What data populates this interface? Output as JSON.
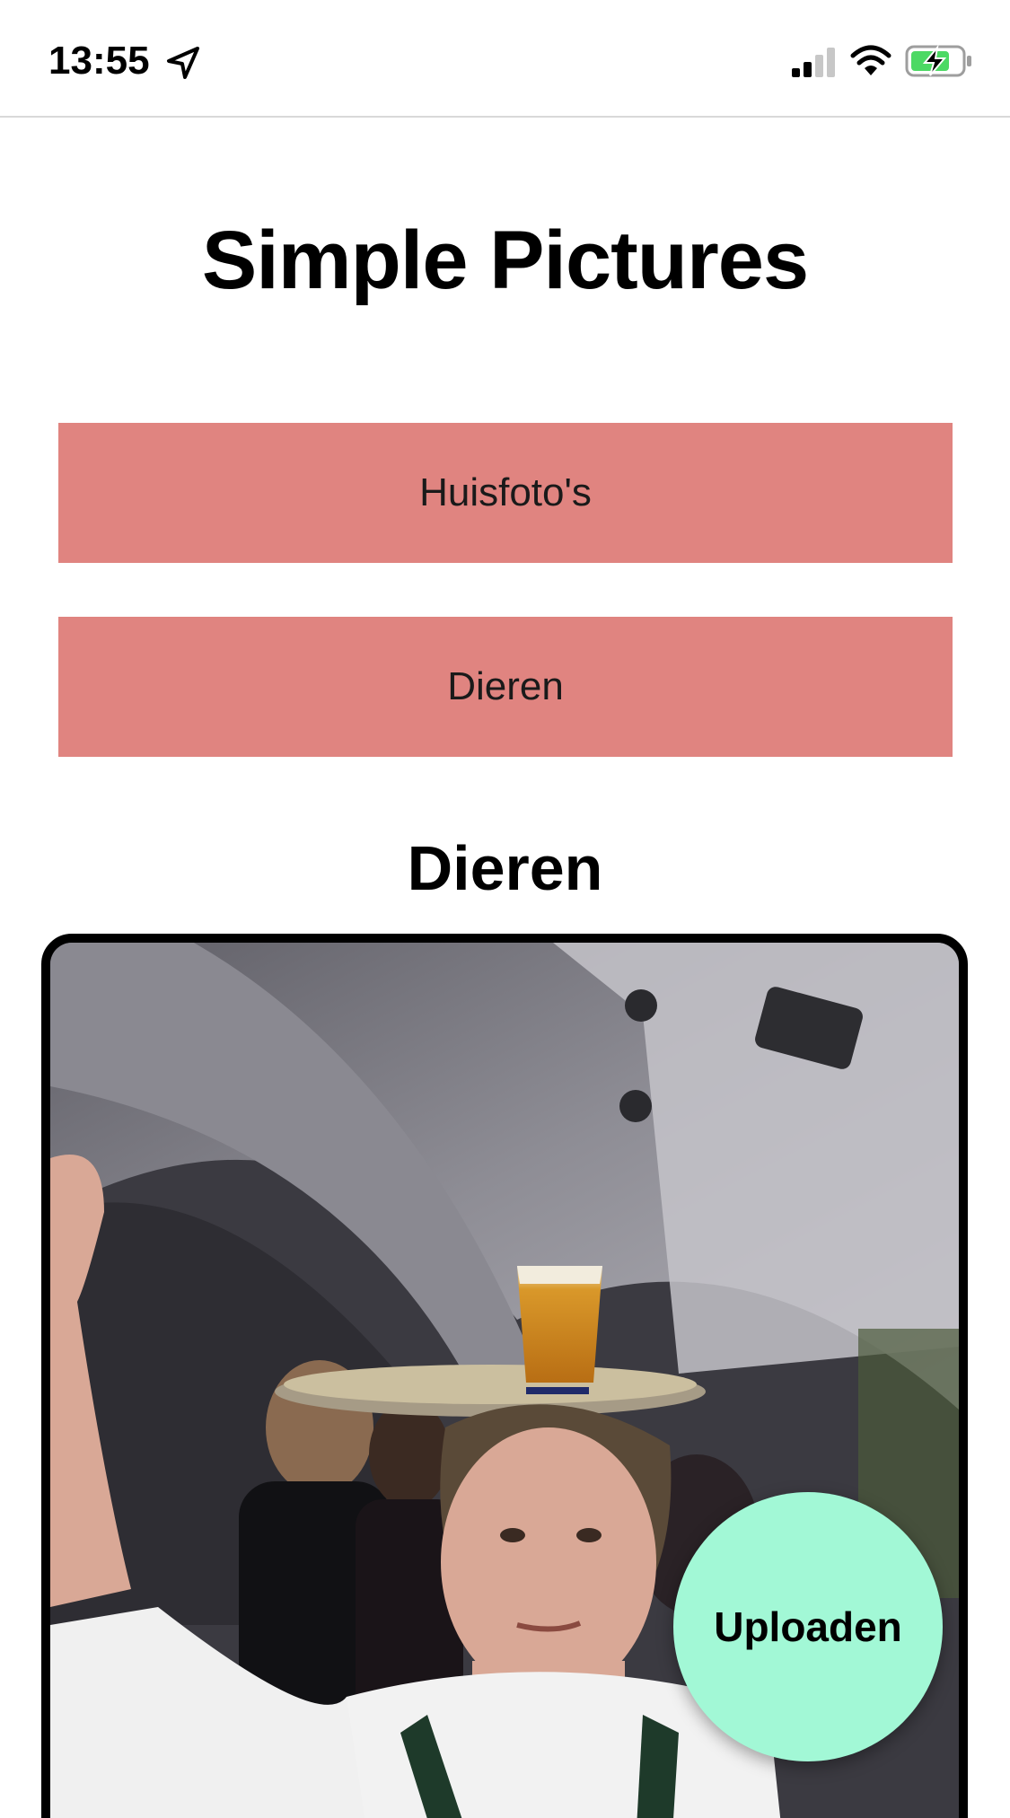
{
  "status_bar": {
    "time": "13:55",
    "icons": [
      "location-arrow-icon",
      "cellular-signal-icon",
      "wifi-icon",
      "battery-charging-icon"
    ],
    "battery_color": "#4cd964"
  },
  "header": {
    "title": "Simple Pictures"
  },
  "categories": [
    {
      "label": "Huisfoto's"
    },
    {
      "label": "Dieren"
    }
  ],
  "gallery": {
    "section_title": "Dieren"
  },
  "actions": {
    "upload_label": "Uploaden"
  },
  "colors": {
    "category_button": "#e08480",
    "upload_button": "#a2f8d6",
    "photo_border": "#000000"
  }
}
